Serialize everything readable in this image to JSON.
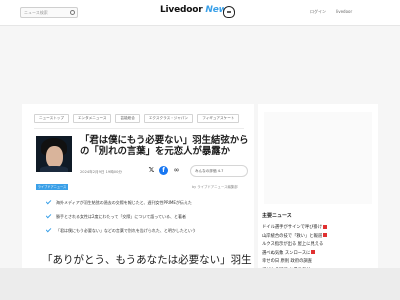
{
  "header": {
    "search_placeholder": "ニュース検索",
    "logo_main": "Livedoor",
    "logo_sub": "News",
    "login": "ログイン",
    "member": "livedoor"
  },
  "breadcrumbs": [
    "ニューストップ",
    "エンタメニュース",
    "芸能総合",
    "エクスクラス・ジャパン",
    "フィギュアスケート"
  ],
  "article": {
    "title": "「君は僕にもう必要ない」羽生結弦からの「別れの言葉」を元恋人が暴露か",
    "date": "2024年2月9日 19時00分",
    "like_label": "みんなの評価 4.7",
    "badge": "ライブドアニュース",
    "source": "by ライブドアニュース編集部",
    "bullets": [
      "海外メディアが羽生結弦の過去の交際を報じたと、週刊女性PRIMEが伝えた",
      "勝手とされる女性は2度にわたって「交際」について語っている、と著者",
      "「君は僕にもう必要ない」などの言葉で別れを告げられた、と明かしたという"
    ],
    "lead": "「ありがとう、もうあなたは必要ない」羽生"
  },
  "sidebar": {
    "title": "主要ニュース",
    "items": [
      "ドイル選手がサインで呼び掛け",
      "山岸統合の技で「救い」と報道",
      "ルクス指示が出る 屋上に見える",
      "選べぬ気象 スンロースに",
      "幸せの日 原則 政府の調査",
      "子どもの国で お参り気分"
    ]
  },
  "colors": {
    "accent": "#3aa0e8",
    "facebook": "#1877f2",
    "new_badge": "#e03131"
  }
}
